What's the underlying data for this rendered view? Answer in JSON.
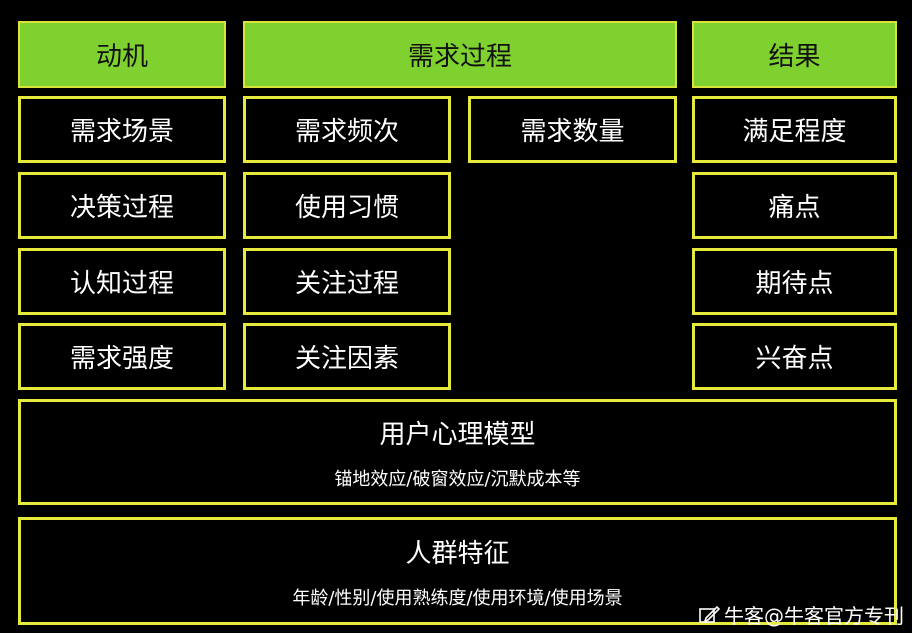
{
  "headers": {
    "motivation": "动机",
    "process": "需求过程",
    "result": "结果"
  },
  "motivation_items": [
    "需求场景",
    "决策过程",
    "认知过程",
    "需求强度"
  ],
  "process_items": [
    "需求频次",
    "使用习惯",
    "关注过程",
    "关注因素"
  ],
  "process_extra": "需求数量",
  "result_items": [
    "满足程度",
    "痛点",
    "期待点",
    "兴奋点"
  ],
  "psychology": {
    "title": "用户心理模型",
    "subtitle": "锚地效应/破窗效应/沉默成本等"
  },
  "crowd": {
    "title": "人群特征",
    "subtitle": "年龄/性别/使用熟练度/使用环境/使用场景"
  },
  "watermark": "牛客@牛客官方专刊"
}
